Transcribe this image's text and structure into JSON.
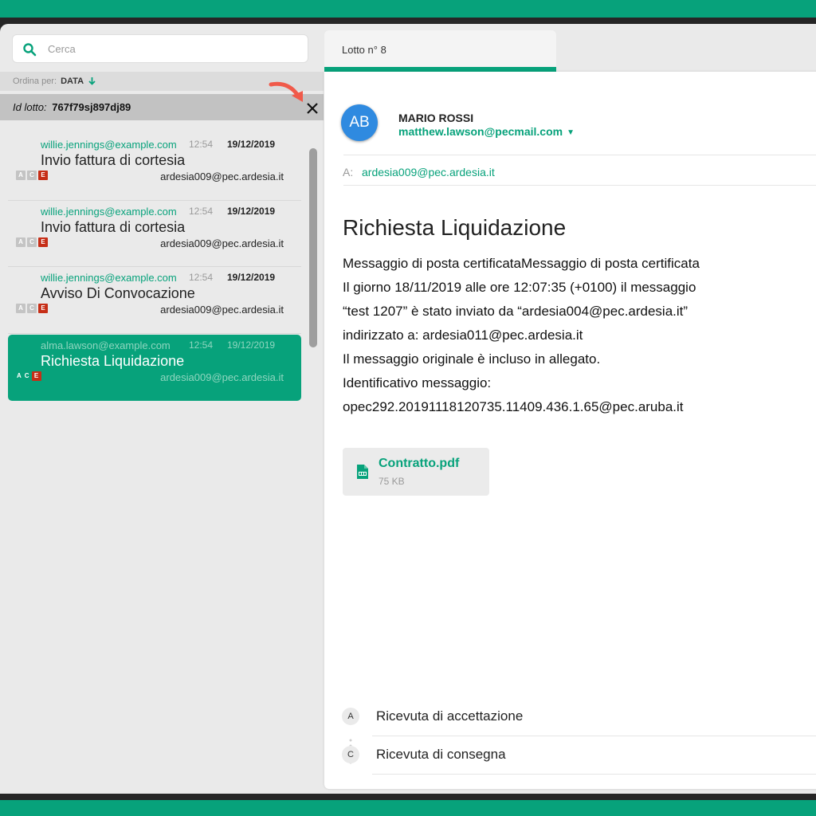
{
  "search": {
    "placeholder": "Cerca"
  },
  "sort": {
    "label": "Ordina per:",
    "value": "DATA"
  },
  "lot": {
    "label": "Id lotto:",
    "value": "767f79sj897dj89"
  },
  "messages": [
    {
      "from": "willie.jennings@example.com",
      "time": "12:54",
      "date": "19/12/2019",
      "subject": "Invio fattura di cortesia",
      "to": "ardesia009@pec.ardesia.it",
      "badges": [
        "A",
        "C",
        "E"
      ]
    },
    {
      "from": "willie.jennings@example.com",
      "time": "12:54",
      "date": "19/12/2019",
      "subject": "Invio fattura di cortesia",
      "to": "ardesia009@pec.ardesia.it",
      "badges": [
        "A",
        "C",
        "E"
      ]
    },
    {
      "from": "willie.jennings@example.com",
      "time": "12:54",
      "date": "19/12/2019",
      "subject": "Avviso Di Convocazione",
      "to": "ardesia009@pec.ardesia.it",
      "badges": [
        "A",
        "C",
        "E"
      ]
    },
    {
      "from": "alma.lawson@example.com",
      "time": "12:54",
      "date": "19/12/2019",
      "subject": "Richiesta Liquidazione",
      "to": "ardesia009@pec.ardesia.it",
      "badges": [
        "A",
        "C",
        "E"
      ]
    }
  ],
  "tab": {
    "label": "Lotto n° 8"
  },
  "detail": {
    "avatar": "AB",
    "sender_name": "MARIO ROSSI",
    "sender_email": "matthew.lawson@pecmail.com",
    "caret": "▼",
    "to_label": "A:",
    "to": "ardesia009@pec.ardesia.it",
    "subject": "Richiesta Liquidazione",
    "body": [
      "Messaggio di posta certificataMessaggio di posta certificata",
      "Il giorno 18/11/2019 alle ore 12:07:35 (+0100) il messaggio",
      "“test 1207” è stato inviato da “ardesia004@pec.ardesia.it”",
      "indirizzato a: ardesia011@pec.ardesia.it",
      "Il messaggio originale è incluso in allegato.",
      "Identificativo messaggio:",
      "opec292.20191118120735.11409.436.1.65@pec.aruba.it"
    ],
    "attachment": {
      "name": "Contratto.pdf",
      "size": "75 KB"
    },
    "receipts": [
      {
        "letter": "A",
        "label": "Ricevuta di accettazione"
      },
      {
        "letter": "C",
        "label": "Ricevuta di consegna"
      }
    ]
  },
  "colors": {
    "accent": "#07a27b",
    "error_badge": "#c62e17",
    "avatar": "#2f8ae0",
    "hint_arrow": "#f05a4a"
  }
}
